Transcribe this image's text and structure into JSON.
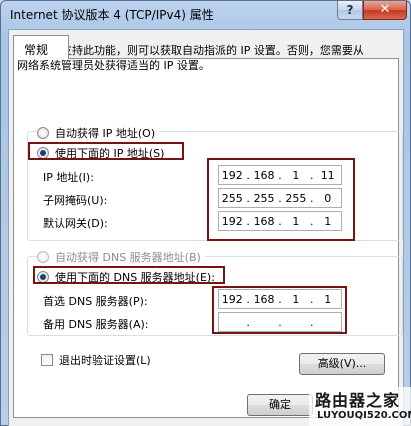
{
  "window": {
    "title": "Internet 协议版本 4 (TCP/IPv4) 属性",
    "help_label": "?",
    "close_label": "✕"
  },
  "tab": {
    "label": "常规"
  },
  "description": "如果网络支持此功能，则可以获取自动指派的 IP 设置。否则，您需要从网络系统管理员处获得适当的 IP 设置。",
  "ip_mode": {
    "auto_label": "自动获得 IP 地址(O)",
    "manual_label": "使用下面的 IP 地址(S)",
    "selected": "manual"
  },
  "ip_fields": [
    {
      "label": "IP 地址(I):",
      "octets": [
        "192",
        "168",
        "1",
        "11"
      ]
    },
    {
      "label": "子网掩码(U):",
      "octets": [
        "255",
        "255",
        "255",
        "0"
      ]
    },
    {
      "label": "默认网关(D):",
      "octets": [
        "192",
        "168",
        "1",
        "1"
      ]
    }
  ],
  "dns_mode": {
    "auto_label": "自动获得 DNS 服务器地址(B)",
    "manual_label": "使用下面的 DNS 服务器地址(E):",
    "selected": "manual"
  },
  "dns_fields": [
    {
      "label": "首选 DNS 服务器(P):",
      "octets": [
        "192",
        "168",
        "1",
        "1"
      ]
    },
    {
      "label": "备用 DNS 服务器(A):",
      "octets": [
        "",
        "",
        "",
        ""
      ]
    }
  ],
  "validate_label": "退出时验证设置(L)",
  "advanced_label": "高级(V)...",
  "ok_label": "确定",
  "dot": ".",
  "watermark": {
    "title": "路由器之家",
    "url": "LUYOUQI520.COM"
  },
  "colors": {
    "highlight_box": "#7b1212",
    "close": "#c7371d"
  }
}
